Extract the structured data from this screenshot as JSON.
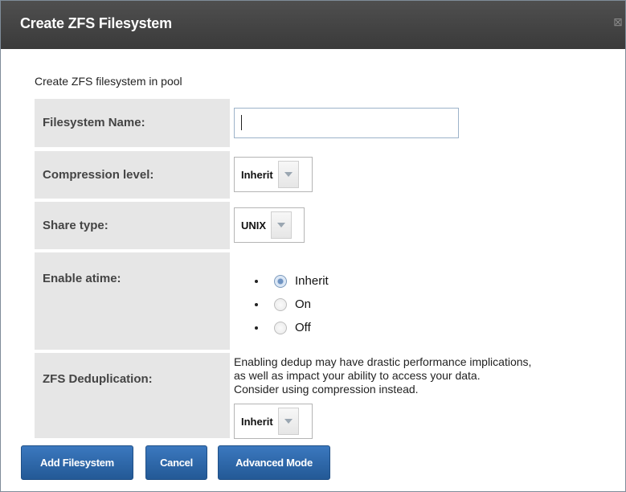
{
  "dialog": {
    "title": "Create ZFS Filesystem",
    "close_glyph": "⊠"
  },
  "form": {
    "intro": "Create ZFS filesystem in pool",
    "filesystem_name": {
      "label": "Filesystem Name:",
      "value": ""
    },
    "compression": {
      "label": "Compression level:",
      "selected": "Inherit"
    },
    "share_type": {
      "label": "Share type:",
      "selected": "UNIX"
    },
    "atime": {
      "label": "Enable atime:",
      "options": [
        {
          "label": "Inherit",
          "checked": true
        },
        {
          "label": "On",
          "checked": false
        },
        {
          "label": "Off",
          "checked": false
        }
      ]
    },
    "dedup": {
      "label": "ZFS Deduplication:",
      "note_lines": [
        "Enabling dedup may have drastic performance implications,",
        "as well as impact your ability to access your data.",
        "Consider using compression instead."
      ],
      "selected": "Inherit"
    }
  },
  "buttons": {
    "add": "Add Filesystem",
    "cancel": "Cancel",
    "advanced": "Advanced Mode"
  },
  "colors": {
    "titlebar": "#444444",
    "label_bg": "#e6e6e6",
    "button": "#2d67a8"
  }
}
